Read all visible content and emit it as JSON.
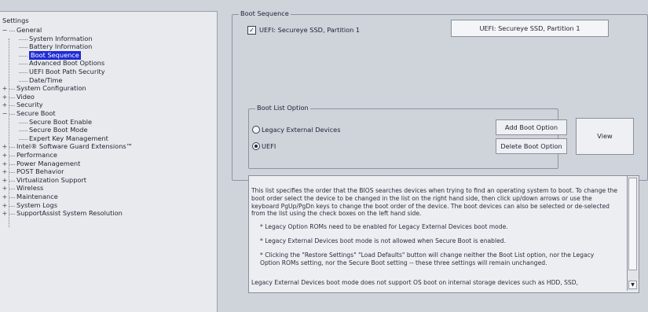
{
  "tree": {
    "root_label": "Settings",
    "items": [
      {
        "label": "General",
        "level": 0,
        "expander": "−"
      },
      {
        "label": "System Information",
        "level": 1
      },
      {
        "label": "Battery Information",
        "level": 1
      },
      {
        "label": "Boot Sequence",
        "level": 1,
        "selected": true
      },
      {
        "label": "Advanced Boot Options",
        "level": 1
      },
      {
        "label": "UEFI Boot Path Security",
        "level": 1
      },
      {
        "label": "Date/Time",
        "level": 1
      },
      {
        "label": "System Configuration",
        "level": 0,
        "expander": "+"
      },
      {
        "label": "Video",
        "level": 0,
        "expander": "+"
      },
      {
        "label": "Security",
        "level": 0,
        "expander": "+"
      },
      {
        "label": "Secure Boot",
        "level": 0,
        "expander": "−"
      },
      {
        "label": "Secure Boot Enable",
        "level": 1
      },
      {
        "label": "Secure Boot Mode",
        "level": 1
      },
      {
        "label": "Expert Key Management",
        "level": 1
      },
      {
        "label": "Intel® Software Guard Extensions™",
        "level": 0,
        "expander": "+"
      },
      {
        "label": "Performance",
        "level": 0,
        "expander": "+"
      },
      {
        "label": "Power Management",
        "level": 0,
        "expander": "+"
      },
      {
        "label": "POST Behavior",
        "level": 0,
        "expander": "+"
      },
      {
        "label": "Virtualization Support",
        "level": 0,
        "expander": "+"
      },
      {
        "label": "Wireless",
        "level": 0,
        "expander": "+"
      },
      {
        "label": "Maintenance",
        "level": 0,
        "expander": "+"
      },
      {
        "label": "System Logs",
        "level": 0,
        "expander": "+"
      },
      {
        "label": "SupportAssist System Resolution",
        "level": 0,
        "expander": "+"
      }
    ]
  },
  "boot_sequence": {
    "title": "Boot Sequence",
    "entry_label": "UEFI: Secureye SSD, Partition 1",
    "entry_checked": true,
    "selected_entry": "UEFI: Secureye SSD, Partition 1"
  },
  "boot_list_option": {
    "title": "Boot List Option",
    "options": [
      {
        "label": "Legacy External Devices",
        "selected": false
      },
      {
        "label": "UEFI",
        "selected": true
      }
    ],
    "add_button": "Add Boot Option",
    "delete_button": "Delete Boot Option",
    "view_button": "View"
  },
  "help": {
    "paragraph": "This list specifies the order that the BIOS searches devices when trying to find an operating system to boot. To change the boot order select the device to be changed in the list on the right hand side, then click up/down arrows or use the keyboard PgUp/PgDn keys to change the boot order of the device. The boot devices can also be selected or de-selected from the list using the check boxes on the left hand side.",
    "bullet1": "* Legacy Option ROMs need to be enabled for Legacy External Devices boot mode.",
    "bullet2": "* Legacy External Devices boot mode is not allowed when Secure Boot is enabled.",
    "bullet3": "* Clicking the \"Restore Settings\" \"Load Defaults\" button will change neither the Boot List option, nor the Legacy Option ROMs setting, nor the Secure Boot setting -- these three settings will remain unchanged.",
    "footer": "Legacy External Devices boot mode does not support OS boot on internal storage devices such as HDD, SSD,"
  },
  "icons": {
    "expand": "plus-icon",
    "collapse": "minus-icon",
    "check": "checkmark-icon",
    "scroll_down": "triangle-down-icon"
  },
  "colors": {
    "selection": "#1e2bd4",
    "tree_background": "#e9eaee",
    "panel_background": "#cfd3da"
  }
}
